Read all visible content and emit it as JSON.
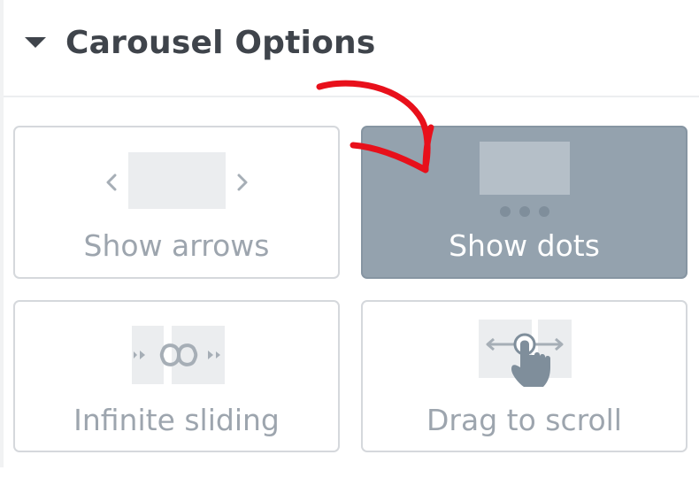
{
  "section": {
    "title": "Carousel Options"
  },
  "options": [
    {
      "label": "Show arrows",
      "selected": false,
      "icon": "arrows-slide-icon"
    },
    {
      "label": "Show dots",
      "selected": true,
      "icon": "dots-slide-icon"
    },
    {
      "label": "Infinite sliding",
      "selected": false,
      "icon": "infinity-icon"
    },
    {
      "label": "Drag to scroll",
      "selected": false,
      "icon": "drag-hand-icon"
    }
  ],
  "annotation": {
    "icon": "red-arrow-icon",
    "color": "#e8101b"
  },
  "colors": {
    "selected_bg": "#94a2ae",
    "border": "#d5d8dc",
    "label": "#9da5ae",
    "title": "#3f444b"
  }
}
